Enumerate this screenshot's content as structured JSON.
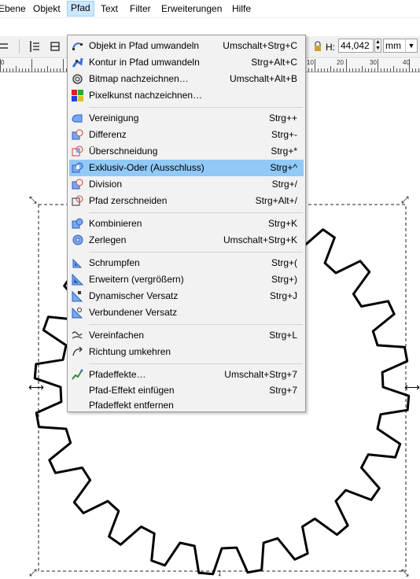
{
  "menubar": {
    "items": [
      {
        "label": "Ebene"
      },
      {
        "label": "Objekt"
      },
      {
        "label": "Pfad"
      },
      {
        "label": "Text"
      },
      {
        "label": "Filter"
      },
      {
        "label": "Erweiterungen"
      },
      {
        "label": "Hilfe"
      }
    ],
    "active": "Pfad"
  },
  "toolbar": {
    "h_label": "H:",
    "h_value": "44,042",
    "unit": "mm"
  },
  "ruler": {
    "labels": [
      "0",
      "10",
      "20",
      "30",
      "40"
    ]
  },
  "path_menu": {
    "items": [
      {
        "label": "Objekt in Pfad umwandeln",
        "shortcut": "Umschalt+Strg+C",
        "icon": "object-to-path-icon"
      },
      {
        "label": "Kontur in Pfad umwandeln",
        "shortcut": "Strg+Alt+C",
        "icon": "stroke-to-path-icon"
      },
      {
        "label": "Bitmap nachzeichnen…",
        "shortcut": "Umschalt+Alt+B",
        "icon": "trace-bitmap-icon"
      },
      {
        "label": "Pixelkunst nachzeichnen…",
        "shortcut": "",
        "icon": "trace-pixel-art-icon"
      },
      {
        "label": "Vereinigung",
        "shortcut": "Strg++",
        "icon": "union-icon"
      },
      {
        "label": "Differenz",
        "shortcut": "Strg+-",
        "icon": "difference-icon"
      },
      {
        "label": "Überschneidung",
        "shortcut": "Strg+*",
        "icon": "intersection-icon"
      },
      {
        "label": "Exklusiv-Oder (Ausschluss)",
        "shortcut": "Strg+^",
        "icon": "exclusion-icon"
      },
      {
        "label": "Division",
        "shortcut": "Strg+/",
        "icon": "division-icon"
      },
      {
        "label": "Pfad zerschneiden",
        "shortcut": "Strg+Alt+/",
        "icon": "cut-path-icon"
      },
      {
        "label": "Kombinieren",
        "shortcut": "Strg+K",
        "icon": "combine-icon"
      },
      {
        "label": "Zerlegen",
        "shortcut": "Umschalt+Strg+K",
        "icon": "break-apart-icon"
      },
      {
        "label": "Schrumpfen",
        "shortcut": "Strg+(",
        "icon": "inset-icon"
      },
      {
        "label": "Erweitern (vergrößern)",
        "shortcut": "Strg+)",
        "icon": "outset-icon"
      },
      {
        "label": "Dynamischer Versatz",
        "shortcut": "Strg+J",
        "icon": "dynamic-offset-icon"
      },
      {
        "label": "Verbundener Versatz",
        "shortcut": "",
        "icon": "linked-offset-icon"
      },
      {
        "label": "Vereinfachen",
        "shortcut": "Strg+L",
        "icon": "simplify-icon"
      },
      {
        "label": "Richtung umkehren",
        "shortcut": "",
        "icon": "reverse-icon"
      },
      {
        "label": "Pfadeffekte…",
        "shortcut": "Umschalt+Strg+7",
        "icon": "path-effects-icon"
      },
      {
        "label": "Pfad-Effekt einfügen",
        "shortcut": "Strg+7",
        "icon": ""
      },
      {
        "label": "Pfadeffekt entfernen",
        "shortcut": "",
        "icon": ""
      }
    ],
    "highlighted": "Exklusiv-Oder (Ausschluss)"
  },
  "colors": {
    "menu_highlight": "#91c9f7",
    "menubar_active": "#cce8ff",
    "icon_blue": "#3b6fd6"
  }
}
